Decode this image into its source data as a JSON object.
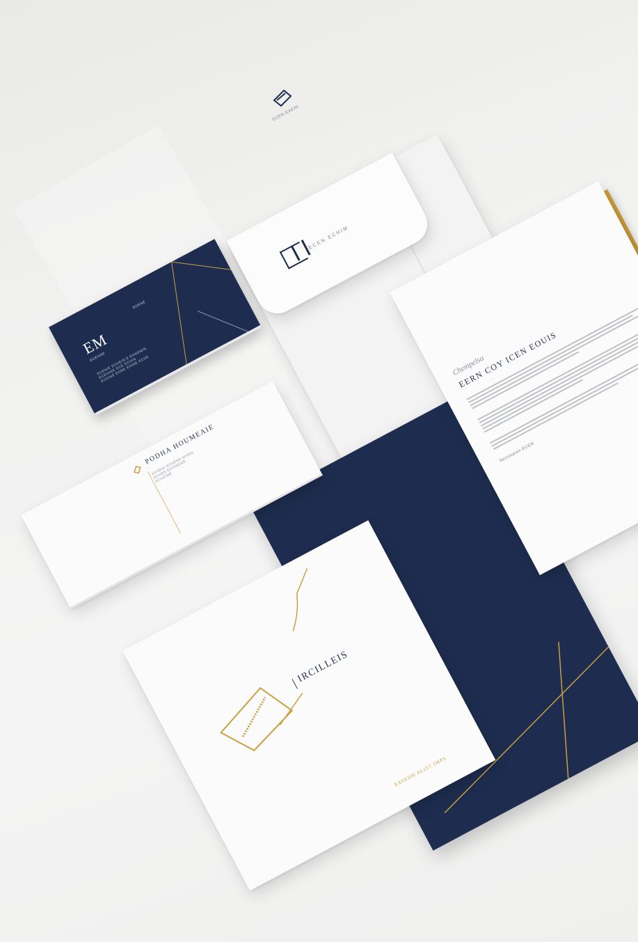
{
  "envelope_flap": {
    "logo_text": "ECEN ECHIM"
  },
  "top_card": {
    "caption": "ECEN EAEIN"
  },
  "business_card": {
    "monogram": "EM",
    "subtitle": "ECEHNE",
    "tag": "EOENE",
    "lines": [
      "ECEHIE ECHEIN E EHNEMIN",
      "ECEHINE ECE ECHIN",
      "ECHINE EHNE EHINE ECHE"
    ]
  },
  "compliment_card": {
    "heading": "PODHA HOUMEAIE",
    "lines": [
      "ECHENI ECHENE NHIEN",
      "ECHEN ECHINENE",
      "ECHEINE"
    ]
  },
  "letterhead": {
    "script_signature": "Chempelsa",
    "heading": "EERN COY ICEN EOUIS",
    "closing": "Secretaren ECEN"
  },
  "notepad": {
    "brand": "IRCILLEIS",
    "footer": "EASEDH ALIST IMPS"
  },
  "colors": {
    "navy": "#1e2d4f",
    "gold": "#c9a03f",
    "paper": "#fbfbfb",
    "background": "#f2f2f2"
  }
}
